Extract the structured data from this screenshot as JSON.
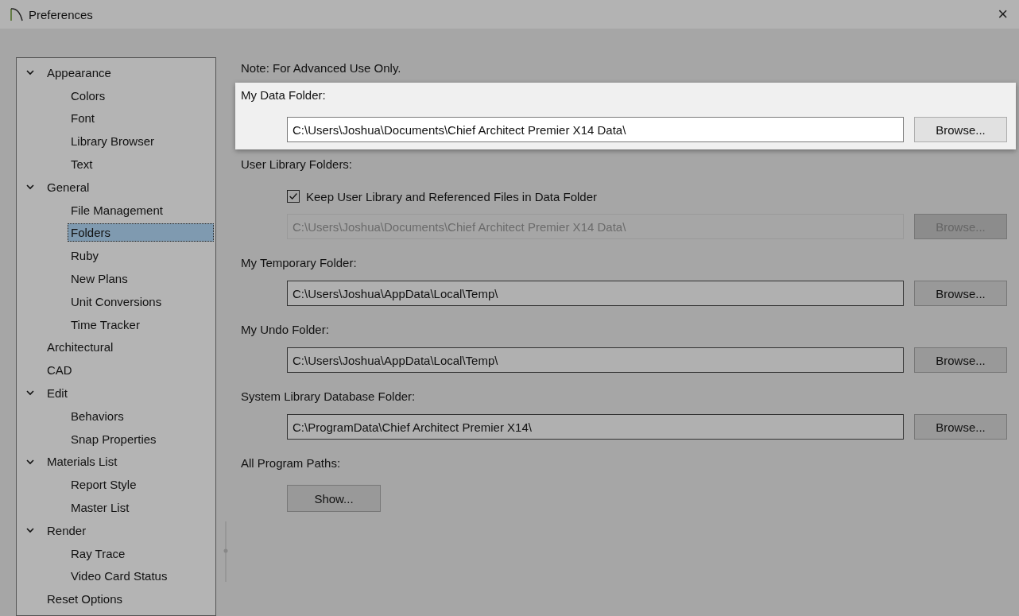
{
  "window": {
    "title": "Preferences",
    "close": "×"
  },
  "tree": [
    {
      "label": "Appearance",
      "expanded": true,
      "selected": false,
      "children": [
        {
          "label": "Colors",
          "selected": false
        },
        {
          "label": "Font",
          "selected": false
        },
        {
          "label": "Library Browser",
          "selected": false
        },
        {
          "label": "Text",
          "selected": false
        }
      ]
    },
    {
      "label": "General",
      "expanded": true,
      "selected": false,
      "children": [
        {
          "label": "File Management",
          "selected": false
        },
        {
          "label": "Folders",
          "selected": true
        },
        {
          "label": "Ruby",
          "selected": false
        },
        {
          "label": "New Plans",
          "selected": false
        },
        {
          "label": "Unit Conversions",
          "selected": false
        },
        {
          "label": "Time Tracker",
          "selected": false
        }
      ]
    },
    {
      "label": "Architectural",
      "selected": false
    },
    {
      "label": "CAD",
      "selected": false
    },
    {
      "label": "Edit",
      "expanded": true,
      "selected": false,
      "children": [
        {
          "label": "Behaviors",
          "selected": false
        },
        {
          "label": "Snap Properties",
          "selected": false
        }
      ]
    },
    {
      "label": "Materials List",
      "expanded": true,
      "selected": false,
      "children": [
        {
          "label": "Report Style",
          "selected": false
        },
        {
          "label": "Master List",
          "selected": false
        }
      ]
    },
    {
      "label": "Render",
      "expanded": true,
      "selected": false,
      "children": [
        {
          "label": "Ray Trace",
          "selected": false
        },
        {
          "label": "Video Card Status",
          "selected": false
        }
      ]
    },
    {
      "label": "Reset Options",
      "selected": false
    }
  ],
  "note": "Note: For Advanced Use Only.",
  "sections": [
    {
      "kind": "path",
      "label": "My Data Folder:",
      "highlighted": true,
      "value": "C:\\Users\\Joshua\\Documents\\Chief Architect Premier X14 Data\\",
      "disabled": false,
      "browse": "Browse..."
    },
    {
      "kind": "path",
      "label": "User Library Folders:",
      "highlighted": false,
      "checkbox": {
        "label": "Keep User Library and Referenced Files in Data Folder",
        "checked": true
      },
      "value": "C:\\Users\\Joshua\\Documents\\Chief Architect Premier X14 Data\\",
      "disabled": true,
      "browse": "Browse..."
    },
    {
      "kind": "path",
      "label": "My Temporary Folder:",
      "highlighted": false,
      "value": "C:\\Users\\Joshua\\AppData\\Local\\Temp\\",
      "disabled": false,
      "browse": "Browse..."
    },
    {
      "kind": "path",
      "label": "My Undo Folder:",
      "highlighted": false,
      "value": "C:\\Users\\Joshua\\AppData\\Local\\Temp\\",
      "disabled": false,
      "browse": "Browse..."
    },
    {
      "kind": "path",
      "label": "System Library Database Folder:",
      "highlighted": false,
      "value": "C:\\ProgramData\\Chief Architect Premier X14\\",
      "disabled": false,
      "browse": "Browse..."
    },
    {
      "kind": "button",
      "label": "All Program Paths:",
      "button": "Show..."
    }
  ]
}
